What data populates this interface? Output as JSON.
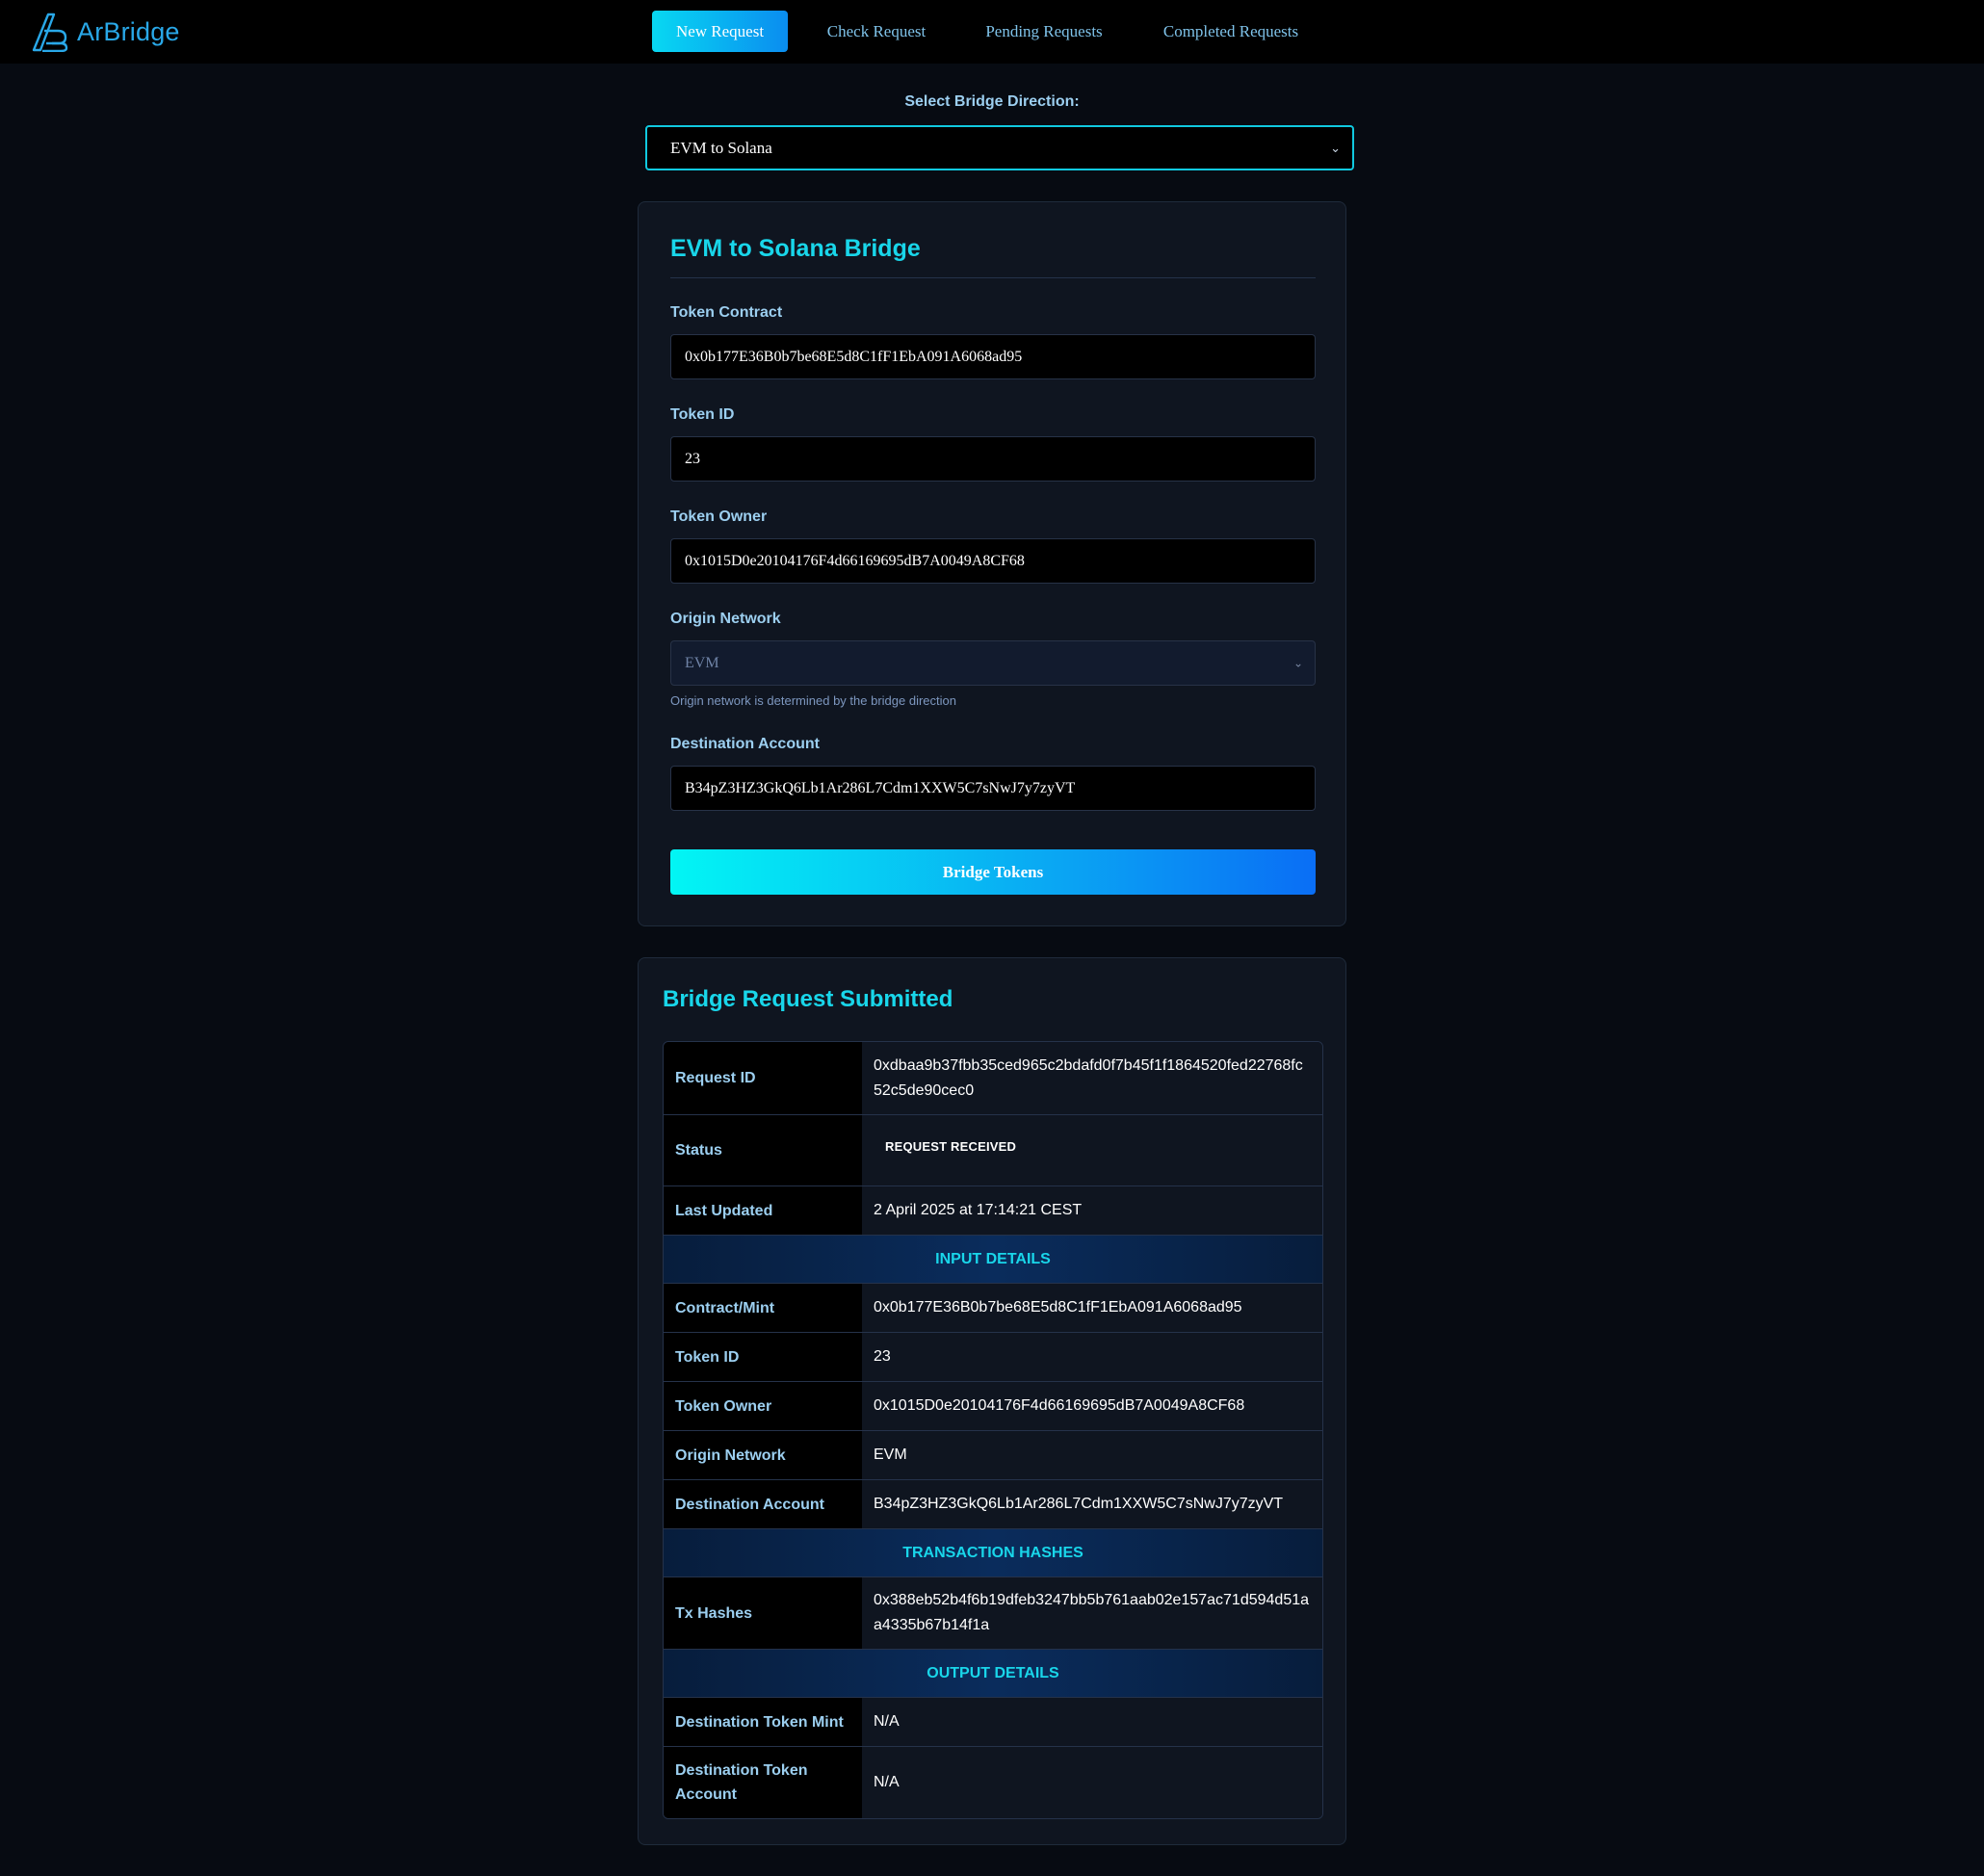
{
  "header": {
    "logo_text": "ArBridge",
    "nav": [
      {
        "label": "New Request",
        "active": true
      },
      {
        "label": "Check Request"
      },
      {
        "label": "Pending Requests"
      },
      {
        "label": "Completed Requests"
      }
    ]
  },
  "direction": {
    "label": "Select Bridge Direction:",
    "selected": "EVM to Solana"
  },
  "form": {
    "title": "EVM to Solana Bridge",
    "token_contract_label": "Token Contract",
    "token_contract_value": "0x0b177E36B0b7be68E5d8C1fF1EbA091A6068ad95",
    "token_id_label": "Token ID",
    "token_id_value": "23",
    "token_owner_label": "Token Owner",
    "token_owner_value": "0x1015D0e20104176F4d66169695dB7A0049A8CF68",
    "origin_network_label": "Origin Network",
    "origin_network_value": "EVM",
    "origin_network_hint": "Origin network is determined by the bridge direction",
    "destination_label": "Destination Account",
    "destination_value": "B34pZ3HZ3GkQ6Lb1Ar286L7Cdm1XXW5C7sNwJ7y7zyVT",
    "submit_label": "Bridge Tokens"
  },
  "result": {
    "title": "Bridge Request Submitted",
    "request_id_label": "Request ID",
    "request_id_value": "0xdbaa9b37fbb35ced965c2bdafd0f7b45f1f1864520fed22768fc52c5de90cec0",
    "status_label": "Status",
    "status_value": "REQUEST RECEIVED",
    "last_updated_label": "Last Updated",
    "last_updated_value": "2 April 2025 at 17:14:21 CEST",
    "input_section": "INPUT DETAILS",
    "contract_label": "Contract/Mint",
    "contract_value": "0x0b177E36B0b7be68E5d8C1fF1EbA091A6068ad95",
    "token_id_label": "Token ID",
    "token_id_value": "23",
    "token_owner_label": "Token Owner",
    "token_owner_value": "0x1015D0e20104176F4d66169695dB7A0049A8CF68",
    "origin_network_label": "Origin Network",
    "origin_network_value": "EVM",
    "destination_account_label": "Destination Account",
    "destination_account_value": "B34pZ3HZ3GkQ6Lb1Ar286L7Cdm1XXW5C7sNwJ7y7zyVT",
    "tx_section": "TRANSACTION HASHES",
    "tx_hashes_label": "Tx Hashes",
    "tx_hashes_value": "0x388eb52b4f6b19dfeb3247bb5b761aab02e157ac71d594d51aa4335b67b14f1a",
    "output_section": "OUTPUT DETAILS",
    "dest_mint_label": "Destination Token Mint",
    "dest_mint_value": "N/A",
    "dest_account_label": "Destination Token Account",
    "dest_account_value": "N/A"
  },
  "colors": {
    "accent": "#19d6ea",
    "label": "#9ccff0",
    "background": "#070b12",
    "card": "#0f1520"
  },
  "icons": {
    "logo": "arbridge-logo-icon",
    "select": "chevron-down-icon"
  }
}
